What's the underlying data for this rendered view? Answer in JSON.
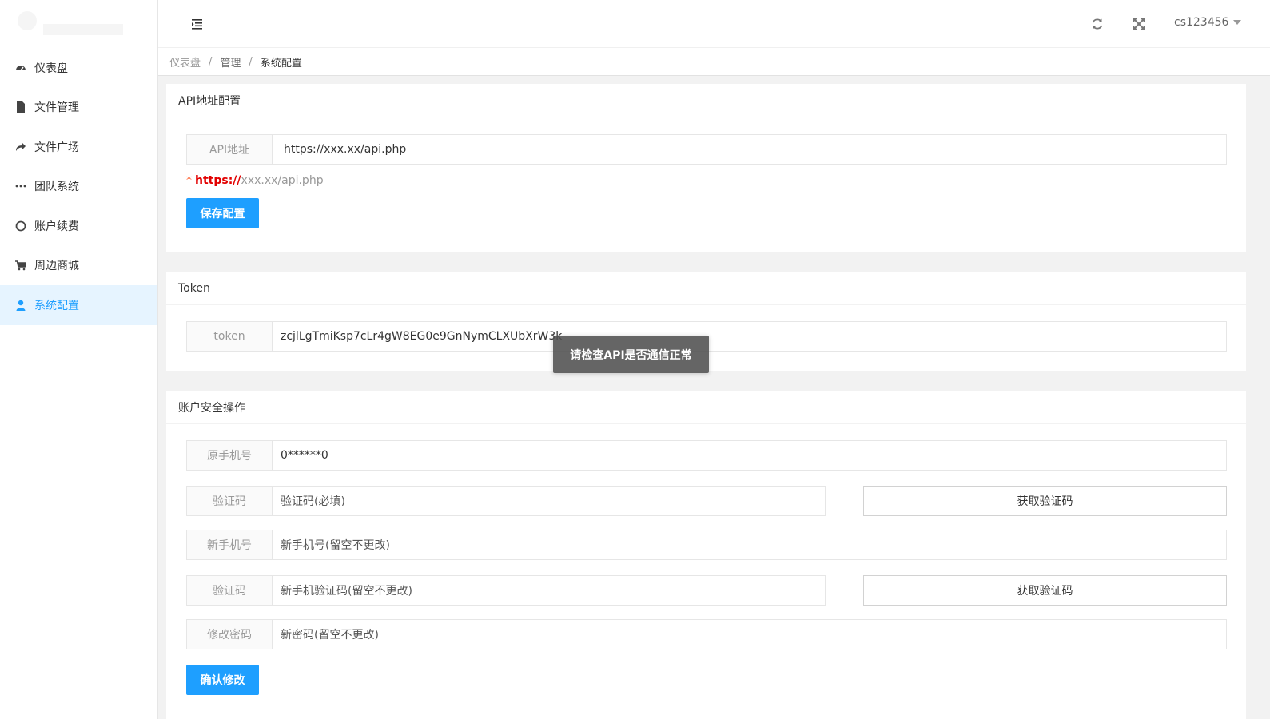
{
  "header": {
    "user": "cs123456"
  },
  "sidebar": {
    "items": [
      {
        "label": "仪表盘",
        "icon": "dashboard-icon"
      },
      {
        "label": "文件管理",
        "icon": "file-icon"
      },
      {
        "label": "文件广场",
        "icon": "share-icon"
      },
      {
        "label": "团队系统",
        "icon": "ellipsis-icon"
      },
      {
        "label": "账户续费",
        "icon": "circle-icon"
      },
      {
        "label": "周边商城",
        "icon": "cart-icon"
      },
      {
        "label": "系统配置",
        "icon": "user-icon",
        "active": true
      }
    ]
  },
  "breadcrumb": [
    "仪表盘",
    "管理",
    "系统配置"
  ],
  "api_card": {
    "title": "API地址配置",
    "label": "API地址",
    "value": "https://xxx.xx/api.php",
    "hint_star": "*",
    "hint_bold": "https://",
    "hint_rest": "xxx.xx/api.php",
    "save_button": "保存配置"
  },
  "token_card": {
    "title": "Token",
    "label": "token",
    "value": "zcjlLgTmiKsp7cLr4gW8EG0e9GnNymCLXUbXrW3k"
  },
  "security_card": {
    "title": "账户安全操作",
    "old_phone_label": "原手机号",
    "old_phone_value": "0******0",
    "code_label": "验证码",
    "code_placeholder": "验证码(必填)",
    "get_code_button": "获取验证码",
    "new_phone_label": "新手机号",
    "new_phone_placeholder": "新手机号(留空不更改)",
    "new_code_label": "验证码",
    "new_code_placeholder": "新手机验证码(留空不更改)",
    "get_code_button_2": "获取验证码",
    "password_label": "修改密码",
    "password_placeholder": "新密码(留空不更改)",
    "confirm_button": "确认修改"
  },
  "toast": "请检查API是否通信正常",
  "colors": {
    "primary": "#1e9fff",
    "hint_red": "#e20000",
    "active_bg": "#e6f4ff"
  }
}
